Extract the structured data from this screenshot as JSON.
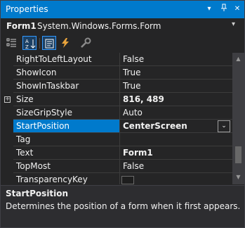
{
  "window": {
    "title": "Properties",
    "titlebar_buttons": [
      "▾",
      "⊥",
      "✕"
    ]
  },
  "object_selector": {
    "name": "Form1",
    "type": "System.Windows.Forms.Form",
    "dropdown_icon": "▾"
  },
  "toolbar": {
    "tools": [
      {
        "name": "categorized",
        "icon": "categorized-icon",
        "active": false
      },
      {
        "name": "alphabetical",
        "icon": "alphabetical-sort-icon",
        "active": true
      },
      {
        "name": "properties",
        "icon": "properties-icon",
        "active": true
      },
      {
        "name": "events",
        "icon": "lightning-icon",
        "active": false
      },
      {
        "name": "property-pages",
        "icon": "wrench-icon",
        "active": false
      }
    ]
  },
  "properties": [
    {
      "name": "RightToLeftLayout",
      "value": "False"
    },
    {
      "name": "ShowIcon",
      "value": "True"
    },
    {
      "name": "ShowInTaskbar",
      "value": "True"
    },
    {
      "name": "Size",
      "value": "816, 489",
      "bold": true,
      "expandable": true,
      "expander": "+"
    },
    {
      "name": "SizeGripStyle",
      "value": "Auto"
    },
    {
      "name": "StartPosition",
      "value": "CenterScreen",
      "bold": true,
      "selected": true,
      "dropdown": "⌄"
    },
    {
      "name": "Tag",
      "value": ""
    },
    {
      "name": "Text",
      "value": "Form1",
      "bold": true
    },
    {
      "name": "TopMost",
      "value": "False"
    },
    {
      "name": "TransparencyKey",
      "value": "",
      "swatch": true
    }
  ],
  "description": {
    "title": "StartPosition",
    "text": "Determines the position of a form when it first appears."
  },
  "colors": {
    "accent": "#007acc",
    "background": "#252526",
    "text": "#f1f1f1"
  }
}
